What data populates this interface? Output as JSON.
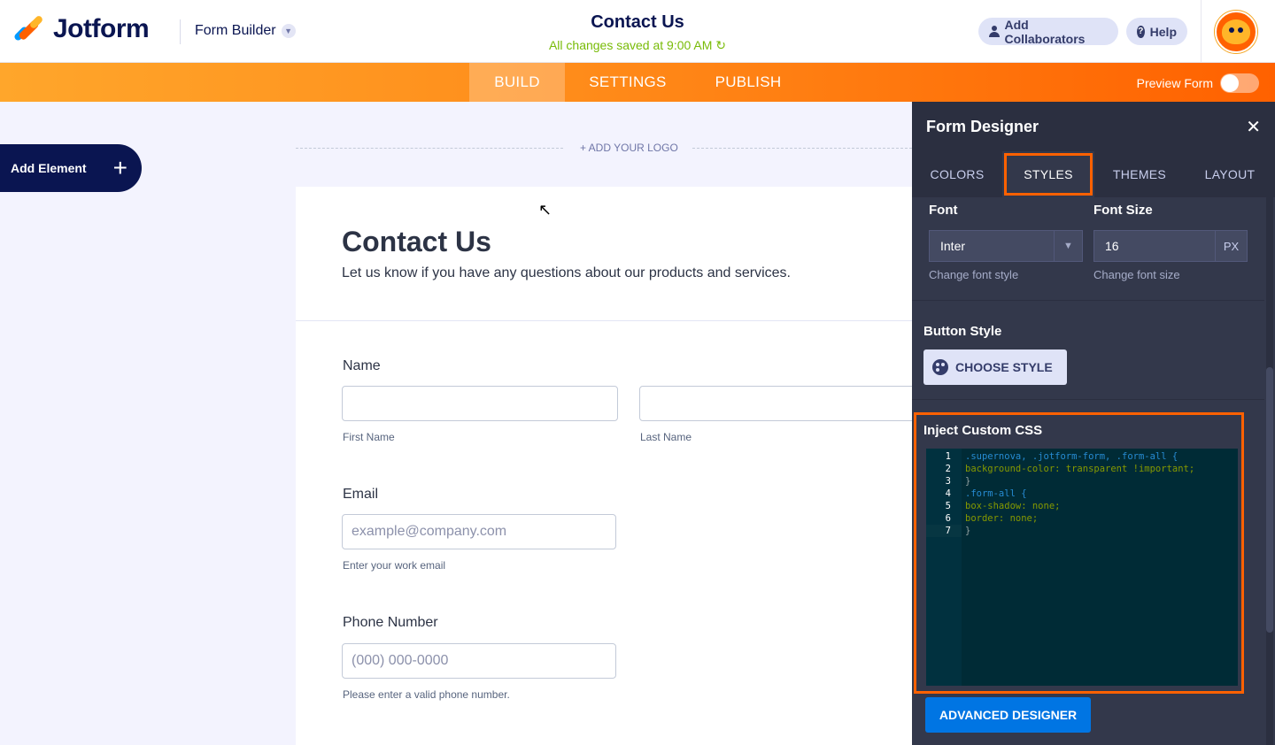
{
  "header": {
    "brand": "Jotform",
    "builder_menu": "Form Builder",
    "form_title": "Contact Us",
    "save_status": "All changes saved at 9:00 AM",
    "collab_label": "Add Collaborators",
    "help_label": "Help"
  },
  "nav": {
    "tabs": [
      "BUILD",
      "SETTINGS",
      "PUBLISH"
    ],
    "active_tab": "BUILD",
    "preview_label": "Preview Form",
    "preview_enabled": false
  },
  "canvas": {
    "add_element_label": "Add Element",
    "add_logo_label": "+ ADD YOUR LOGO"
  },
  "form": {
    "title": "Contact Us",
    "subtitle": "Let us know if you have any questions about our products and services.",
    "fields": {
      "name_label": "Name",
      "first_name_sub": "First Name",
      "last_name_sub": "Last Name",
      "email_label": "Email",
      "email_placeholder": "example@company.com",
      "email_sub": "Enter your work email",
      "phone_label": "Phone Number",
      "phone_placeholder": "(000) 000-0000",
      "phone_sub": "Please enter a valid phone number."
    }
  },
  "designer": {
    "title": "Form Designer",
    "tabs": [
      "COLORS",
      "STYLES",
      "THEMES",
      "LAYOUT"
    ],
    "active_tab": "STYLES",
    "font_label": "Font",
    "font_value": "Inter",
    "font_help": "Change font style",
    "font_size_label": "Font Size",
    "font_size_value": "16",
    "font_size_unit": "PX",
    "font_size_help": "Change font size",
    "button_style_label": "Button Style",
    "choose_style_label": "CHOOSE STYLE",
    "css_label": "Inject Custom CSS",
    "css_lines": [
      ".supernova, .jotform-form, .form-all {",
      "background-color: transparent !important;",
      "}",
      ".form-all {",
      "box-shadow: none;",
      "border: none;",
      "}"
    ],
    "advanced_label": "ADVANCED DESIGNER"
  },
  "colors": {
    "brand_navy": "#0a1551",
    "accent_orange": "#ff6100",
    "save_green": "#78bb07",
    "advanced_blue": "#0075e3"
  }
}
